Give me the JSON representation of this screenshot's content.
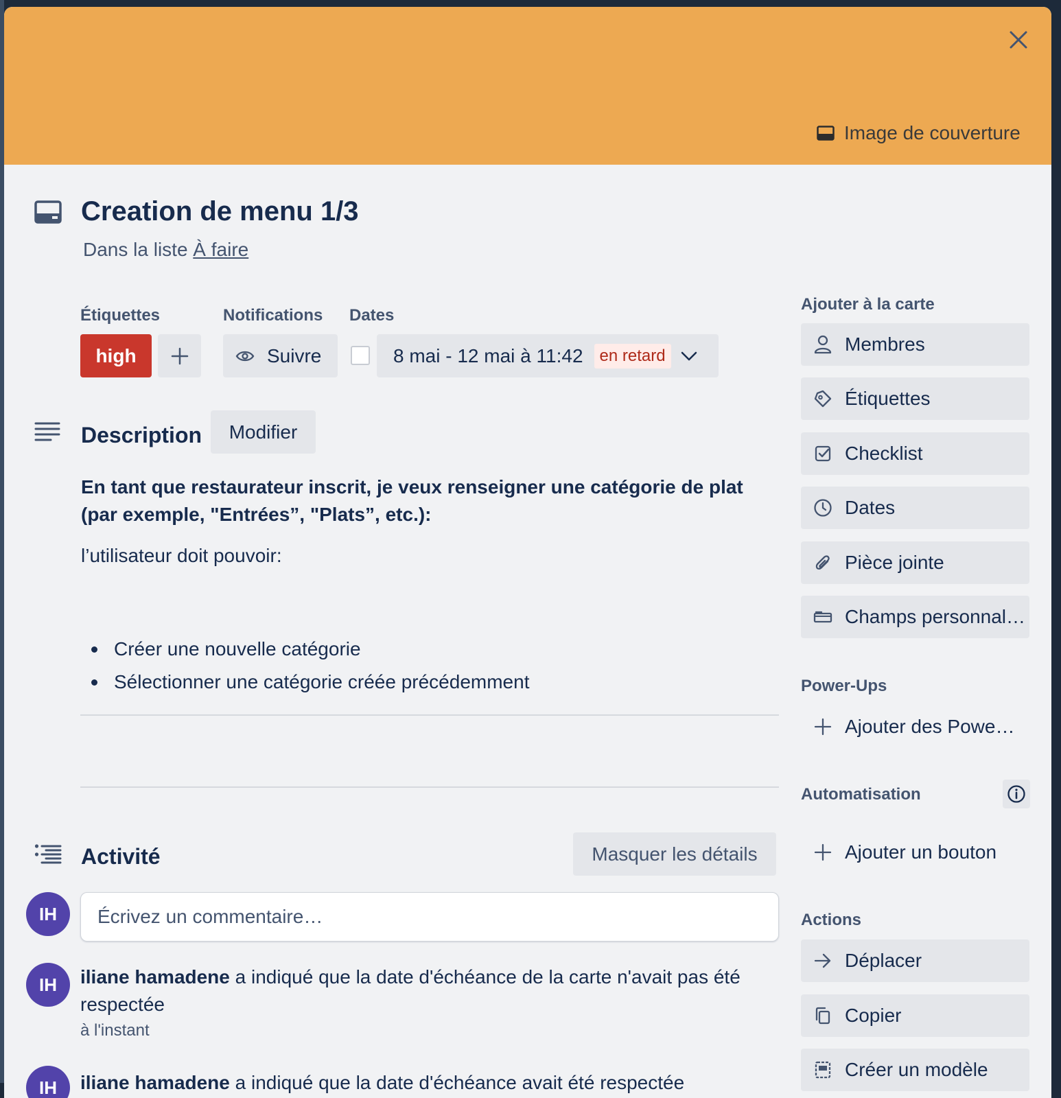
{
  "cover": {
    "color": "#eda952",
    "cover_button_label": "Image de couverture"
  },
  "card": {
    "title": "Creation de menu 1/3",
    "list_prefix": "Dans la liste",
    "list_name": "À faire"
  },
  "labels": {
    "heading": "Étiquettes",
    "items": [
      {
        "name": "high",
        "color": "#c9372c"
      }
    ]
  },
  "notifications": {
    "heading": "Notifications",
    "watch_label": "Suivre"
  },
  "dates": {
    "heading": "Dates",
    "range": "8 mai - 12 mai à 11:42",
    "status": "en retard"
  },
  "description": {
    "heading": "Description",
    "edit_label": "Modifier",
    "bold_text": "En tant que restaurateur inscrit, je veux renseigner une catégorie de plat (par exemple, \"Entrées”, \"Plats”, etc.):",
    "intro": "l’utilisateur doit pouvoir:",
    "bullets": [
      "Créer une nouvelle catégorie",
      "Sélectionner une catégorie créée précédemment"
    ]
  },
  "activity": {
    "heading": "Activité",
    "toggle_details": "Masquer les détails",
    "comment_placeholder": "Écrivez un commentaire…",
    "user_initials": "IH",
    "entries": [
      {
        "initials": "IH",
        "user": "iliane hamadene",
        "text": " a indiqué que la date d'échéance de la carte n'avait pas été respectée",
        "time": "à l'instant"
      },
      {
        "initials": "IH",
        "user": "iliane hamadene",
        "text": " a indiqué que la date d'échéance avait été respectée"
      }
    ]
  },
  "sidebar": {
    "add_to_card_heading": "Ajouter à la carte",
    "add_items": [
      {
        "label": "Membres",
        "icon": "person-icon"
      },
      {
        "label": "Étiquettes",
        "icon": "tag-icon"
      },
      {
        "label": "Checklist",
        "icon": "checklist-icon"
      },
      {
        "label": "Dates",
        "icon": "clock-icon"
      },
      {
        "label": "Pièce jointe",
        "icon": "paperclip-icon"
      },
      {
        "label": "Champs personnali…",
        "icon": "field-icon"
      }
    ],
    "powerups_heading": "Power-Ups",
    "add_powerups": "Ajouter des Powe…",
    "automation_heading": "Automatisation",
    "add_button": "Ajouter un bouton",
    "actions_heading": "Actions",
    "actions": [
      {
        "label": "Déplacer",
        "icon": "arrow-right-icon"
      },
      {
        "label": "Copier",
        "icon": "copy-icon"
      },
      {
        "label": "Créer un modèle",
        "icon": "template-icon"
      }
    ]
  }
}
